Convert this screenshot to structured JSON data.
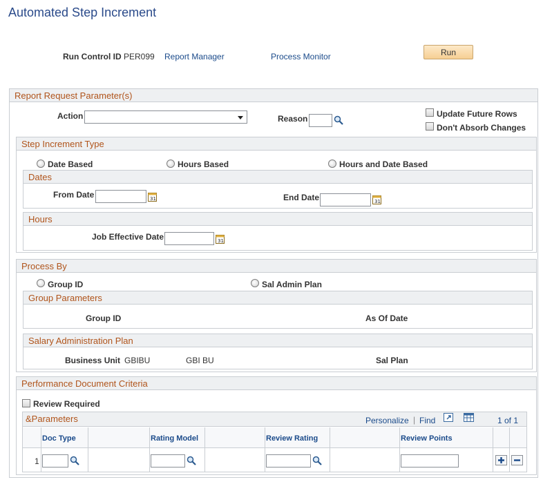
{
  "page": {
    "title": "Automated Step Increment"
  },
  "run_control": {
    "label": "Run Control ID",
    "value": "PER099",
    "report_manager": "Report Manager",
    "process_monitor": "Process Monitor",
    "run_button": "Run"
  },
  "report_params": {
    "header": "Report Request Parameter(s)",
    "action_label": "Action",
    "action_value": "",
    "reason_label": "Reason",
    "reason_value": "",
    "update_future_rows": "Update Future Rows",
    "dont_absorb_changes": "Don't Absorb Changes"
  },
  "step_increment_type": {
    "header": "Step Increment Type",
    "options": [
      "Date Based",
      "Hours Based",
      "Hours and Date Based"
    ],
    "dates": {
      "header": "Dates",
      "from_date_label": "From Date",
      "end_date_label": "End Date"
    },
    "hours": {
      "header": "Hours",
      "job_effective_date_label": "Job Effective Date"
    }
  },
  "process_by": {
    "header": "Process By",
    "options": [
      "Group ID",
      "Sal Admin Plan"
    ],
    "group_parameters": {
      "header": "Group Parameters",
      "group_id_label": "Group ID",
      "as_of_date_label": "As Of Date"
    },
    "salary_admin_plan": {
      "header": "Salary Administration Plan",
      "business_unit_label": "Business Unit",
      "business_unit_value": "GBIBU",
      "business_unit_desc": "GBI BU",
      "sal_plan_label": "Sal Plan"
    }
  },
  "performance": {
    "header": "Performance Document Criteria",
    "review_required": "Review Required",
    "grid": {
      "title": "&Parameters",
      "personalize": "Personalize",
      "separator": "|",
      "find": "Find",
      "pager": "1 of 1",
      "columns": [
        "Doc Type",
        "Rating Model",
        "Review Rating",
        "Review Points"
      ],
      "rows": [
        {
          "num": "1",
          "doc_type": "",
          "rating_model": "",
          "review_rating": "",
          "review_points": ""
        }
      ]
    }
  },
  "icons": {
    "lookup": "magnifier-icon",
    "calendar": "calendar-icon",
    "add": "plus-icon",
    "delete": "minus-icon",
    "view_all": "zoom-icon",
    "download": "spreadsheet-icon"
  },
  "colors": {
    "title": "#2a4a8a",
    "section_header_text": "#b0541b",
    "link": "#1a4a8a",
    "run_button": "#f6cf93"
  }
}
